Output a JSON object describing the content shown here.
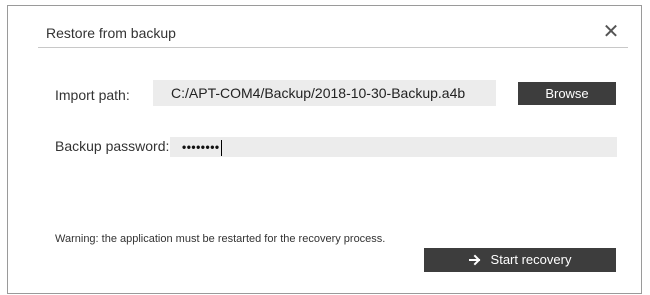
{
  "dialog": {
    "title": "Restore from backup",
    "close_icon": "close-icon"
  },
  "import": {
    "label": "Import path:",
    "value": "C:/APT-COM4/Backup/2018-10-30-Backup.a4b",
    "browse_label": "Browse"
  },
  "password": {
    "label": "Backup password:",
    "masked_value": "••••••••"
  },
  "warning_text": "Warning: the application must be restarted for the recovery process.",
  "start": {
    "label": "Start recovery",
    "icon": "arrow-right-icon"
  },
  "colors": {
    "button_bg": "#3d3d3d",
    "field_bg": "#ececec",
    "border": "#9a9a9a"
  }
}
